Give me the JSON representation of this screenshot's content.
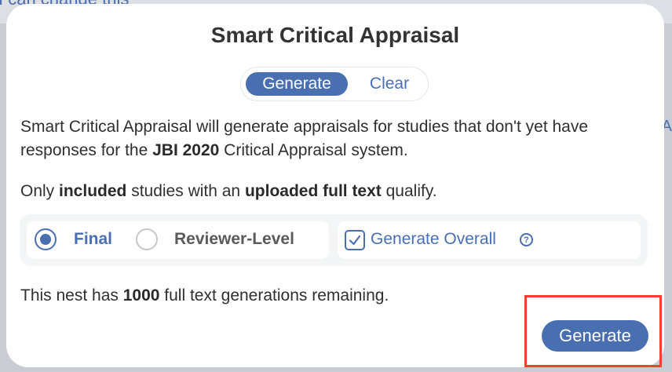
{
  "background": {
    "top_text": "I can change this",
    "right_text": "A"
  },
  "modal": {
    "title": "Smart Critical Appraisal",
    "toggle": {
      "generate_label": "Generate",
      "clear_label": "Clear",
      "selected": "Generate"
    },
    "description": {
      "part1": "Smart Critical Appraisal will generate appraisals for studies that don't yet have responses for the ",
      "bold": "JBI 2020",
      "part2": " Critical Appraisal system."
    },
    "qualify": {
      "part1": "Only ",
      "bold1": "included",
      "part2": " studies with an ",
      "bold2": "uploaded full text",
      "part3": " qualify."
    },
    "options": {
      "final_label": "Final",
      "reviewer_label": "Reviewer-Level",
      "selected": "Final",
      "overall_label": "Generate Overall",
      "overall_checked": true,
      "help_glyph": "?"
    },
    "remaining": {
      "part1": "This nest has ",
      "count": "1000",
      "part2": " full text generations remaining."
    },
    "generate_button": "Generate"
  },
  "colors": {
    "accent": "#4a6fb0",
    "highlight": "#e8452c"
  }
}
